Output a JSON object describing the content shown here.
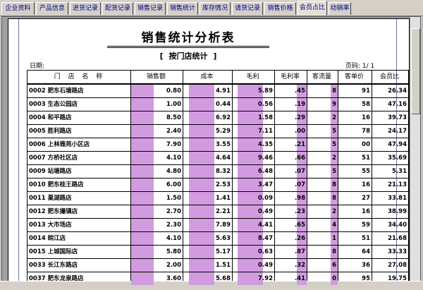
{
  "tabs": [
    {
      "label": "企业资料",
      "active": false
    },
    {
      "label": "产品信息",
      "active": false
    },
    {
      "label": "进货记录",
      "active": false
    },
    {
      "label": "配货记录",
      "active": false
    },
    {
      "label": "销售记录",
      "active": false
    },
    {
      "label": "销售统计",
      "active": false
    },
    {
      "label": "库存情况",
      "active": false
    },
    {
      "label": "请货记录",
      "active": false
    },
    {
      "label": "销售价格",
      "active": false
    },
    {
      "label": "会员占比",
      "active": true
    },
    {
      "label": "动销率",
      "active": false
    }
  ],
  "report": {
    "title": "销售统计分析表",
    "subtitle": "[ 按门店统计 ]",
    "date_label": "日期:",
    "page_label": "页码: 1/ 1"
  },
  "table": {
    "headers": [
      "门 店 名 称",
      "销售额",
      "成本",
      "毛利",
      "毛利率",
      "客流量",
      "客单价",
      "会员比"
    ],
    "rows": [
      [
        "0002 肥东石塘路店",
        "0.80",
        "4.91",
        "5.89",
        ".45",
        "8",
        "91",
        "26.34"
      ],
      [
        "0003 生态公园店",
        "1.00",
        "0.44",
        "0.56",
        ".19",
        "9",
        "58",
        "47.16"
      ],
      [
        "0004 和平路店",
        "8.50",
        "6.92",
        "1.58",
        ".29",
        "2",
        "16",
        "39.73"
      ],
      [
        "0005 胜利路店",
        "2.40",
        "5.29",
        "7.11",
        ".00",
        "5",
        "78",
        "24.17"
      ],
      [
        "0006 上林雅苑小区店",
        "7.90",
        "3.55",
        "4.35",
        ".21",
        "5",
        "00",
        "47.94"
      ],
      [
        "0007 方桥社区店",
        "4.10",
        "4.64",
        "9.46",
        ".66",
        "2",
        "51",
        "35.69"
      ],
      [
        "0009 站塘路店",
        "4.80",
        "8.32",
        "6.48",
        ".07",
        "5",
        "55",
        "5.31"
      ],
      [
        "0010 肥东桂王路店",
        "6.00",
        "2.53",
        "3.47",
        ".07",
        "8",
        "16",
        "21.13"
      ],
      [
        "0011 巢湖路店",
        "1.50",
        "1.41",
        "0.09",
        ".98",
        "8",
        "27",
        "33.81"
      ],
      [
        "0012 肥东撮镇店",
        "2.70",
        "2.21",
        "0.49",
        ".23",
        "2",
        "16",
        "38.99"
      ],
      [
        "0013 大市场店",
        "2.30",
        "7.89",
        "4.41",
        ".65",
        "4",
        "59",
        "34.40"
      ],
      [
        "0014 皖江店",
        "4.10",
        "5.63",
        "8.47",
        ".26",
        "1",
        "51",
        "21.68"
      ],
      [
        "0015 上城国际店",
        "5.80",
        "5.17",
        "0.63",
        ".87",
        "8",
        "64",
        "33.33"
      ],
      [
        "0033 长江东路店",
        "2.00",
        "1.51",
        "0.49",
        ".32",
        "6",
        "36",
        "27.08"
      ],
      [
        "0037 肥东龙泉路店",
        "3.60",
        "5.68",
        "7.92",
        ".41",
        "0",
        "95",
        "19.75"
      ]
    ]
  }
}
